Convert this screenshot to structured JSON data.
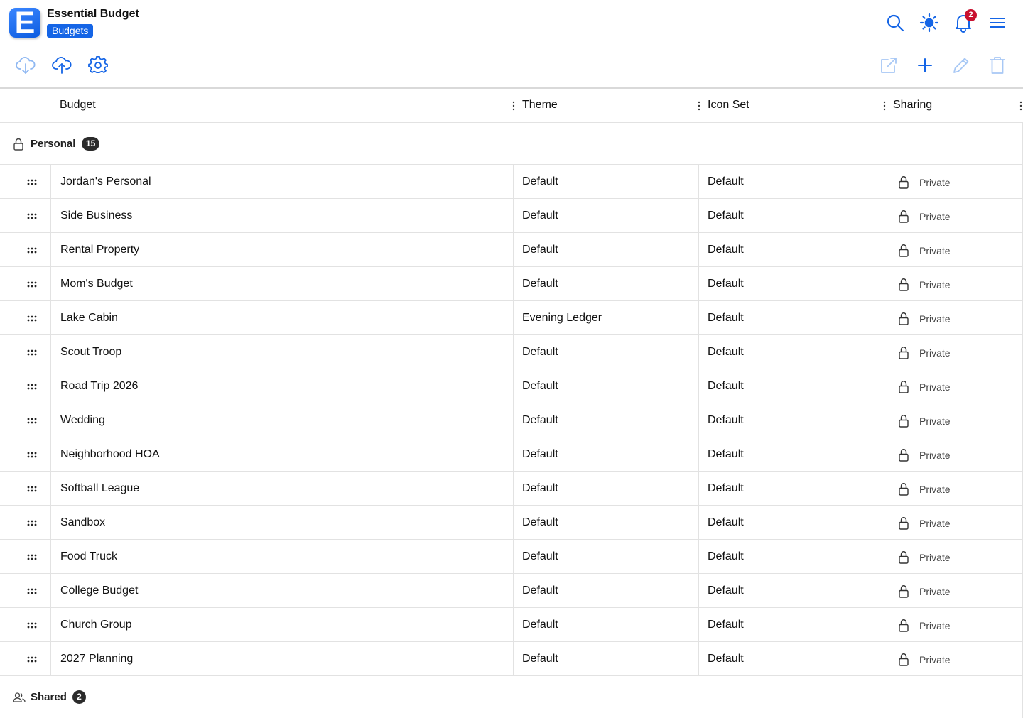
{
  "app": {
    "title": "Essential Budget",
    "badge": "Budgets",
    "logo_letter": "E",
    "notification_count": "2",
    "accent_color": "#1565e6",
    "logo_color": "#2b7bf5",
    "badge_color": "#c8102e"
  },
  "header_icons": [
    "search-icon",
    "sun-icon",
    "bell-icon",
    "menu-icon"
  ],
  "toolbar": {
    "left_icons": [
      "cloud-download-icon",
      "cloud-upload-icon",
      "gear-icon"
    ],
    "right_icons": [
      "external-link-icon",
      "plus-icon",
      "pencil-icon",
      "trash-icon"
    ]
  },
  "table": {
    "columns": [
      "Budget",
      "Theme",
      "Icon Set",
      "Sharing"
    ],
    "groups": [
      {
        "label": "Personal",
        "count": "15",
        "icon": "lock-icon",
        "rows": [
          {
            "budget": "Jordan's Personal",
            "theme": "Default",
            "icon_set": "Default",
            "sharing": "Private"
          },
          {
            "budget": "Side Business",
            "theme": "Default",
            "icon_set": "Default",
            "sharing": "Private"
          },
          {
            "budget": "Rental Property",
            "theme": "Default",
            "icon_set": "Default",
            "sharing": "Private"
          },
          {
            "budget": "Mom's Budget",
            "theme": "Default",
            "icon_set": "Default",
            "sharing": "Private"
          },
          {
            "budget": "Lake Cabin",
            "theme": "Evening Ledger",
            "icon_set": "Default",
            "sharing": "Private"
          },
          {
            "budget": "Scout Troop",
            "theme": "Default",
            "icon_set": "Default",
            "sharing": "Private"
          },
          {
            "budget": "Road Trip 2026",
            "theme": "Default",
            "icon_set": "Default",
            "sharing": "Private"
          },
          {
            "budget": "Wedding",
            "theme": "Default",
            "icon_set": "Default",
            "sharing": "Private"
          },
          {
            "budget": "Neighborhood HOA",
            "theme": "Default",
            "icon_set": "Default",
            "sharing": "Private"
          },
          {
            "budget": "Softball League",
            "theme": "Default",
            "icon_set": "Default",
            "sharing": "Private"
          },
          {
            "budget": "Sandbox",
            "theme": "Default",
            "icon_set": "Default",
            "sharing": "Private"
          },
          {
            "budget": "Food Truck",
            "theme": "Default",
            "icon_set": "Default",
            "sharing": "Private"
          },
          {
            "budget": "College Budget",
            "theme": "Default",
            "icon_set": "Default",
            "sharing": "Private"
          },
          {
            "budget": "Church Group",
            "theme": "Default",
            "icon_set": "Default",
            "sharing": "Private"
          },
          {
            "budget": "2027 Planning",
            "theme": "Default",
            "icon_set": "Default",
            "sharing": "Private"
          }
        ]
      },
      {
        "label": "Shared",
        "count": "2",
        "icon": "users-icon",
        "rows": []
      }
    ]
  }
}
